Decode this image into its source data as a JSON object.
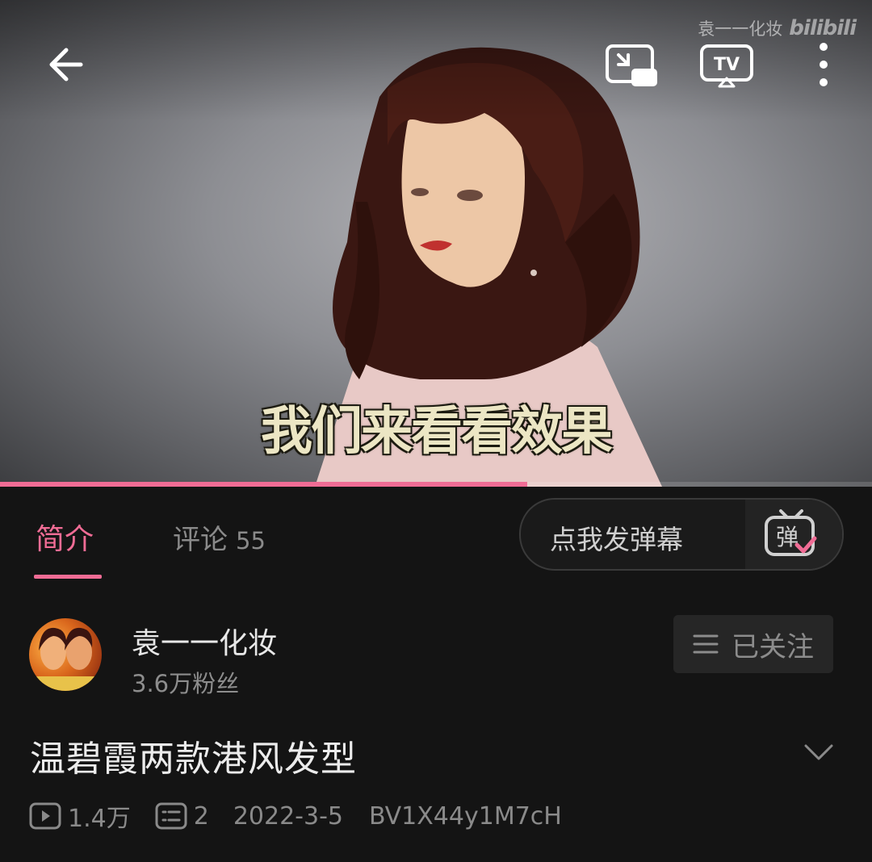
{
  "player": {
    "watermark_channel": "袁一一化妆",
    "watermark_brand": "bilibili",
    "subtitle": "我们来看看效果",
    "progress": 0.605,
    "accent_color": "#f06c95"
  },
  "tabs": {
    "intro_label": "简介",
    "comments_label": "评论",
    "comments_count": "55",
    "danmaku_placeholder": "点我发弹幕",
    "danmaku_icon_text": "弹"
  },
  "uploader": {
    "name": "袁一一化妆",
    "fans": "3.6万粉丝",
    "follow_label": "已关注"
  },
  "video": {
    "title": "温碧霞两款港风发型",
    "views": "1.4万",
    "danmaku_count": "2",
    "date": "2022-3-5",
    "bvid": "BV1X44y1M7cH"
  },
  "icons": {
    "back": "arrow-left-icon",
    "pip": "picture-in-picture-icon",
    "tv": "tv-cast-icon",
    "more": "more-vertical-icon",
    "danmaku": "danmaku-send-icon",
    "follow": "menu-lines-icon",
    "expand": "chevron-down-icon",
    "play": "play-count-icon",
    "danmaku_count": "danmaku-count-icon"
  }
}
